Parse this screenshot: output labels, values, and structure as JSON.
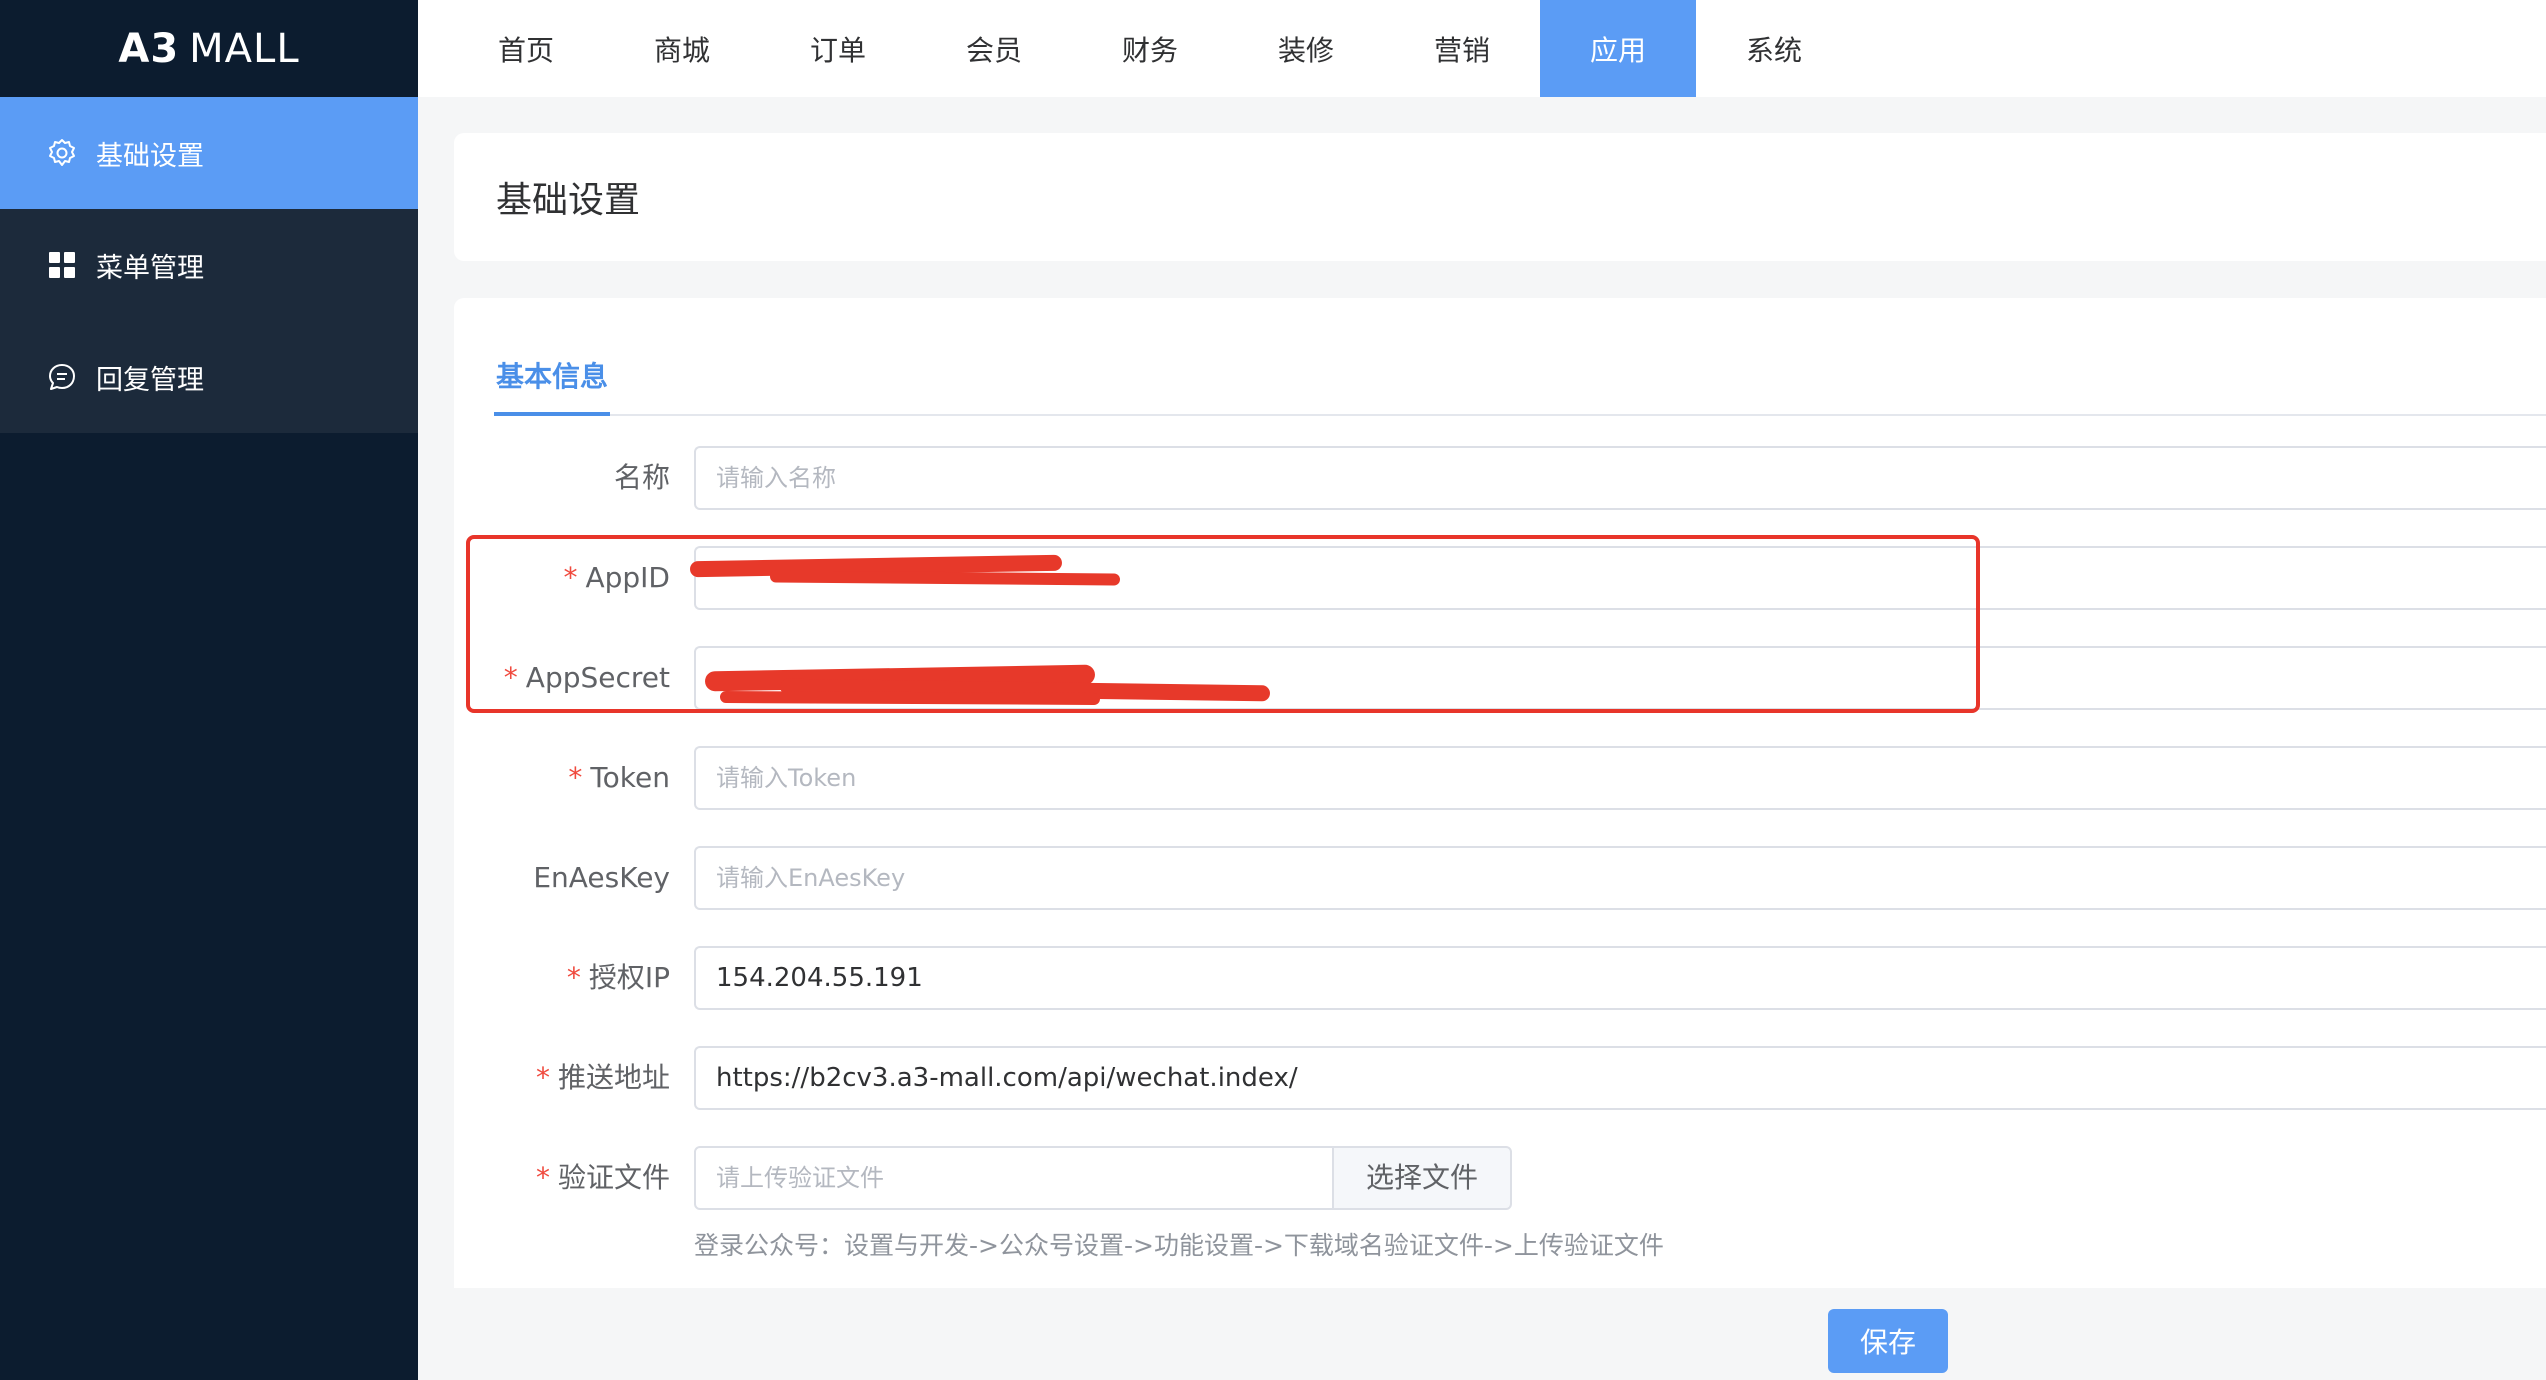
{
  "logo": {
    "bold": "A3",
    "rest": "MALL"
  },
  "sidebar": {
    "items": [
      {
        "label": "基础设置",
        "icon": "gear-icon",
        "active": true
      },
      {
        "label": "菜单管理",
        "icon": "grid-icon",
        "active": false
      },
      {
        "label": "回复管理",
        "icon": "chat-bubble-icon",
        "active": false
      }
    ]
  },
  "topnav": {
    "items": [
      {
        "label": "首页"
      },
      {
        "label": "商城"
      },
      {
        "label": "订单"
      },
      {
        "label": "会员"
      },
      {
        "label": "财务"
      },
      {
        "label": "装修"
      },
      {
        "label": "营销"
      },
      {
        "label": "应用",
        "active": true
      },
      {
        "label": "系统"
      }
    ]
  },
  "page": {
    "title": "基础设置"
  },
  "tabs": {
    "basic": "基本信息"
  },
  "form": {
    "name": {
      "label": "名称",
      "placeholder": "请输入名称"
    },
    "appid": {
      "label": "AppID",
      "required": "*"
    },
    "appsecret": {
      "label": "AppSecret",
      "required": "*"
    },
    "token": {
      "label": "Token",
      "required": "*",
      "placeholder": "请输入Token"
    },
    "enaeskey": {
      "label": "EnAesKey",
      "placeholder": "请输入EnAesKey"
    },
    "ip": {
      "label": "授权IP",
      "required": "*",
      "value": "154.204.55.191"
    },
    "push_url": {
      "label": "推送地址",
      "required": "*",
      "value": "https://b2cv3.a3-mall.com/api/wechat.index/"
    },
    "verify_file": {
      "label": "验证文件",
      "required": "*",
      "placeholder": "请上传验证文件",
      "button": "选择文件",
      "hint": "登录公众号：设置与开发->公众号设置->功能设置->下载域名验证文件->上传验证文件"
    }
  },
  "actions": {
    "save": "保存"
  },
  "colors": {
    "sidebar_bg": "#0c1c2f",
    "accent": "#5b9cf5",
    "required": "#f04a3e",
    "redaction": "#e7392a"
  }
}
